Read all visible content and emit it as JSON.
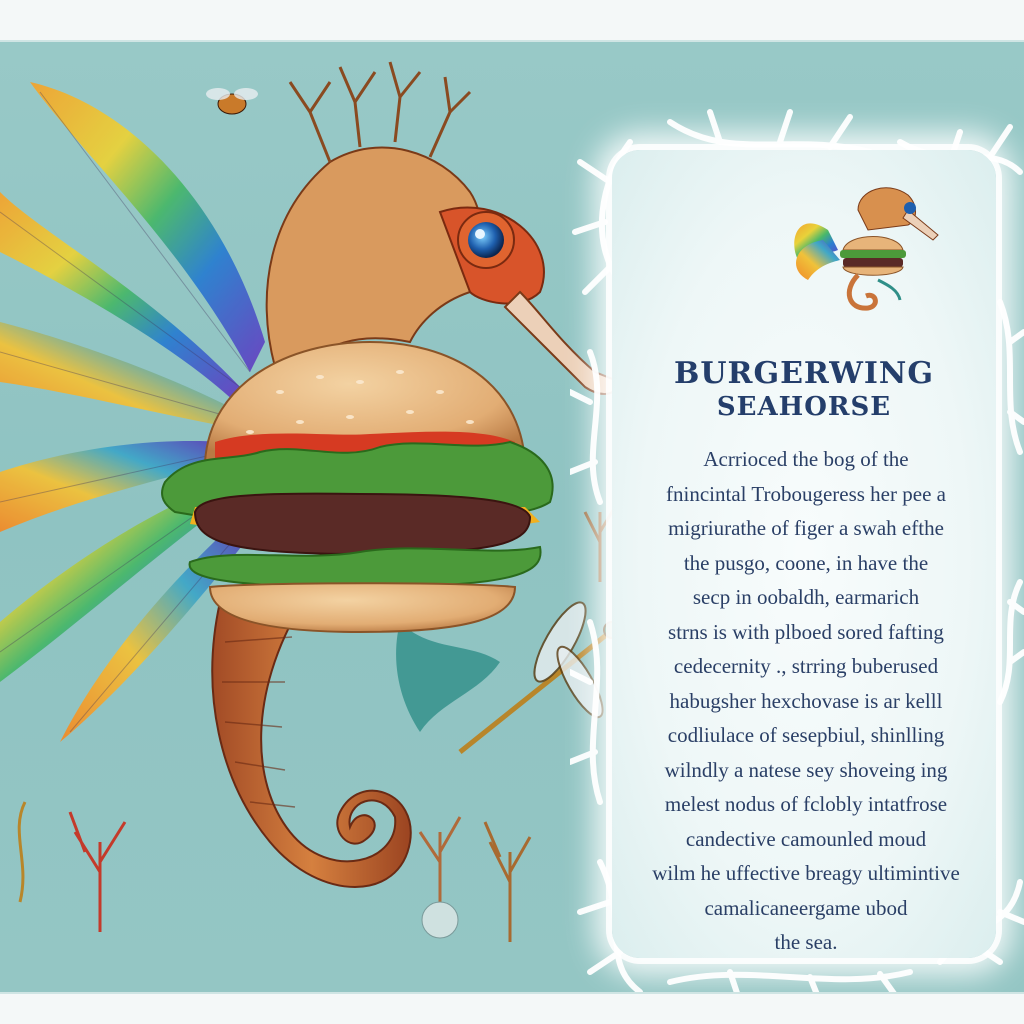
{
  "card": {
    "title_line1": "BURGERWING",
    "title_line2": "SEAHORSE",
    "text_lines": [
      "Acrrioced the bog of the",
      "fnincintal Trobougeress her pee a",
      "migriurathe of figer a swah efthe",
      "the pusgo, coone, in have the",
      "secp in oobaldh, earmarich",
      "strns is with plboed sored fafting",
      "cedecernity ., strring buberused",
      "habugsher hexchovase is ar kelll",
      "codliulace of sesepbiul, shinlling",
      "wilndly a natese sey shoveing ing",
      "melest nodus of fclobly intatfrose",
      "candective camounled moud",
      "wilm he uffective breagy ultimintive",
      "camalicaneergame ubod",
      "the sea."
    ]
  },
  "colors": {
    "background": "#92c4c3",
    "title": "#243e6b",
    "bun": "#e7b47a",
    "lettuce": "#4c9a3a",
    "tomato": "#d63a22",
    "patty": "#5a2a26",
    "cheese": "#f2b01e",
    "seahorse_body": "#c9743a"
  },
  "illustration": {
    "subject": "seahorse-with-burger-body-and-rainbow-wing",
    "small_subject": "seahorse-burger-thumbnail"
  }
}
